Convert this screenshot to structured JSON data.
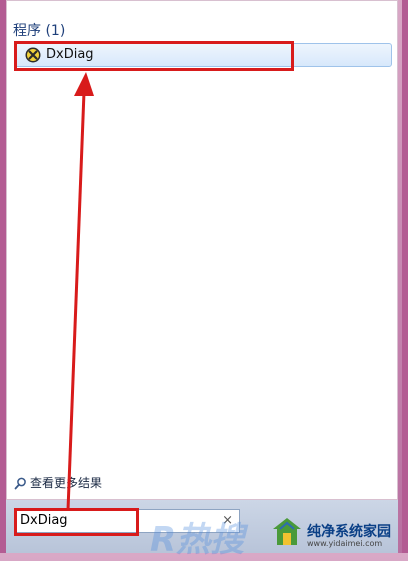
{
  "results": {
    "section_title": "程序 (1)",
    "items": [
      {
        "label": "DxDiag",
        "icon": "dxdiag-icon"
      }
    ]
  },
  "footer": {
    "more_results": "查看更多结果"
  },
  "search": {
    "value": "DxDiag",
    "clear_symbol": "×"
  },
  "watermark": {
    "brand": "纯净系统家园",
    "url": "www.yidaimei.com"
  },
  "colors": {
    "highlight": "#d81b1b",
    "frame": "#b35c93",
    "section_title": "#1e3f7a"
  }
}
